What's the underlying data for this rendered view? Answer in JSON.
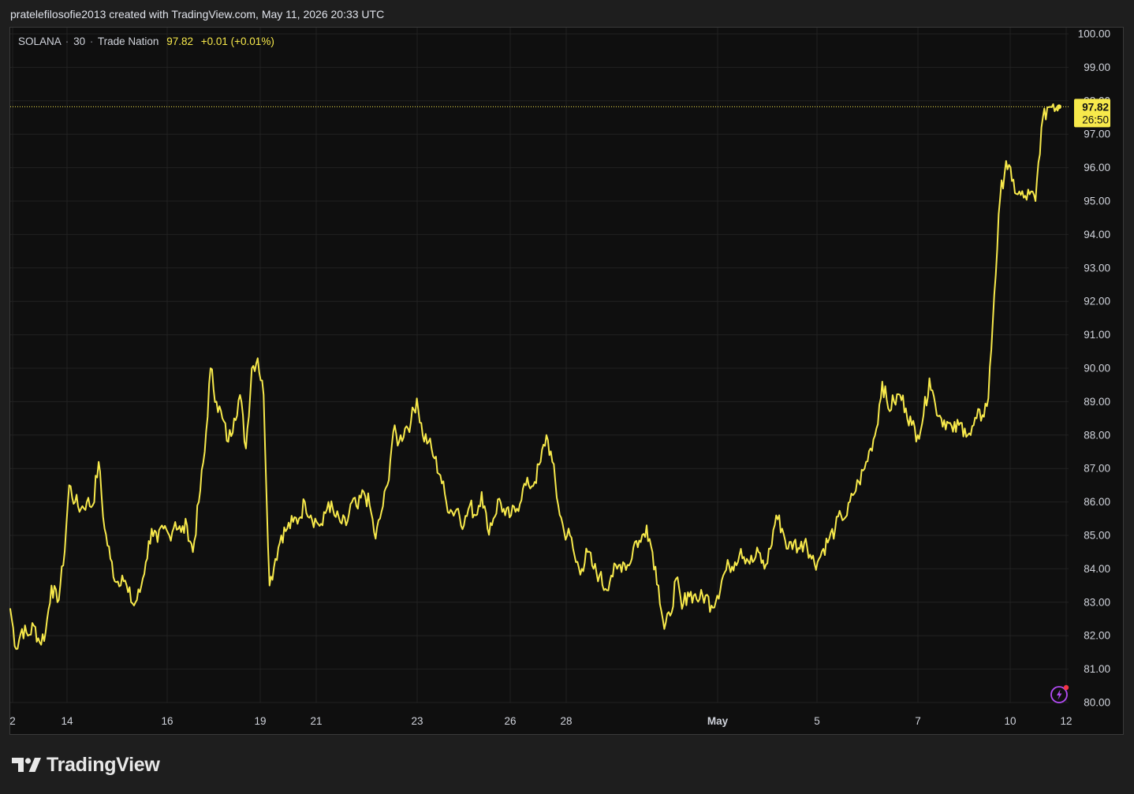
{
  "header": {
    "credit": "pratelefilosofie2013 created with TradingView.com, May 11, 2026 20:33 UTC"
  },
  "legend": {
    "symbol": "SOLANA",
    "interval": "30",
    "broker": "Trade Nation",
    "last": "97.82",
    "change": "+0.01 (+0.01%)"
  },
  "price_label": {
    "price": "97.82",
    "countdown": "26:50"
  },
  "branding": {
    "name": "TradingView"
  },
  "colors": {
    "line": "#f7e94b",
    "background": "#0f0f0f",
    "grid": "#222222",
    "axis_text": "#d1d4dc",
    "alert_icon": "#b24bf3"
  },
  "chart_data": {
    "type": "line",
    "series": [
      {
        "values": [
          82.8,
          81.6,
          82.2,
          82.0,
          82.3,
          81.8,
          82.1,
          83.5,
          83.0,
          84.1,
          86.5,
          86.0,
          85.8,
          86.0,
          85.9,
          87.2,
          85.2,
          84.3,
          83.6,
          83.8,
          83.3,
          82.9,
          83.3,
          84.2,
          85.2,
          84.8,
          85.2,
          85.0,
          85.4,
          85.1,
          85.3,
          84.5,
          86.0,
          87.5,
          90.0,
          89.0,
          88.5,
          87.8,
          88.5,
          89.2,
          87.6,
          90.0,
          90.3,
          89.2,
          83.5,
          84.3,
          85.0,
          85.2,
          85.4,
          85.5,
          86.0,
          85.6,
          85.4,
          85.3,
          86.0,
          85.6,
          85.4,
          85.3,
          86.0,
          85.8,
          86.3,
          85.9,
          84.9,
          85.7,
          86.5,
          88.1,
          87.8,
          88.2,
          88.4,
          89.1,
          88.0,
          87.8,
          87.3,
          86.8,
          86.0,
          85.7,
          85.8,
          85.3,
          85.9,
          85.6,
          86.3,
          85.2,
          85.5,
          86.1,
          85.6,
          85.6,
          85.8,
          86.4,
          86.5,
          86.6,
          87.2,
          88.0,
          87.2,
          85.9,
          85.1,
          85.0,
          84.2,
          84.0,
          84.5,
          84.0,
          83.8,
          83.4,
          83.8,
          84.0,
          84.2,
          84.1,
          84.8,
          84.8,
          85.3,
          84.5,
          83.5,
          82.2,
          82.6,
          83.7,
          82.8,
          83.3,
          83.2,
          83.1,
          83.2,
          82.9,
          83.2,
          83.8,
          84.1,
          84.2,
          84.6,
          84.3,
          84.2,
          84.5,
          84.0,
          84.6,
          85.6,
          85.2,
          84.6,
          84.8,
          84.6,
          84.9,
          84.3,
          84.2,
          84.6,
          84.9,
          85.2,
          85.6,
          85.6,
          86.2,
          86.6,
          87.0,
          87.6,
          88.2,
          89.6,
          88.8,
          89.0,
          89.2,
          88.8,
          88.3,
          88.0,
          88.6,
          89.7,
          88.9,
          88.5,
          88.4,
          88.1,
          88.3,
          88.2,
          88.0,
          88.5,
          88.6,
          89.1,
          92.2,
          95.1,
          96.2,
          95.6,
          95.2,
          95.1,
          95.2,
          95.0,
          97.2,
          97.8,
          97.9,
          97.82
        ],
        "note": ""
      }
    ],
    "x_ticks": [
      "2",
      "14",
      "16",
      "19",
      "21",
      "23",
      "26",
      "28",
      "May",
      "5",
      "7",
      "10",
      "12"
    ],
    "y_ticks": [
      "100.00",
      "99.00",
      "98.00",
      "97.00",
      "96.00",
      "95.00",
      "94.00",
      "93.00",
      "92.00",
      "91.00",
      "90.00",
      "89.00",
      "88.00",
      "87.00",
      "86.00",
      "85.00",
      "84.00",
      "83.00",
      "82.00",
      "81.00",
      "80.00"
    ],
    "ylim": [
      80,
      100
    ],
    "last_price": 97.82,
    "grid": true,
    "xlabel": "",
    "ylabel": ""
  }
}
